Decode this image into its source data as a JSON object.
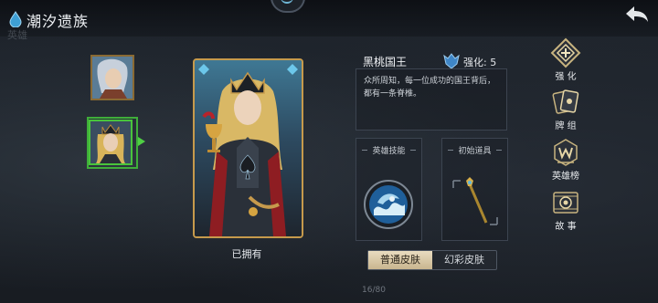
{
  "header": {
    "title": "潮汐遗族",
    "ghost_text": "英雄"
  },
  "hero": {
    "name": "黑桃国王",
    "enhance_label": "强化: 5",
    "description": "众所周知，每一位成功的国王背后，都有一条脊椎。",
    "status": "已拥有"
  },
  "panels": {
    "skill_title": "英雄技能",
    "item_title": "初始道具"
  },
  "skins": {
    "normal": "普通皮肤",
    "color": "幻彩皮肤"
  },
  "pager": {
    "text": "16/80"
  },
  "menu": {
    "enhance": "强 化",
    "deck": "牌 组",
    "ranking": "英雄榜",
    "story": "故 事"
  },
  "colors": {
    "accent_gold": "#c69a4c",
    "selected_green": "#3fae3a",
    "panel_border": "#3c4450"
  }
}
